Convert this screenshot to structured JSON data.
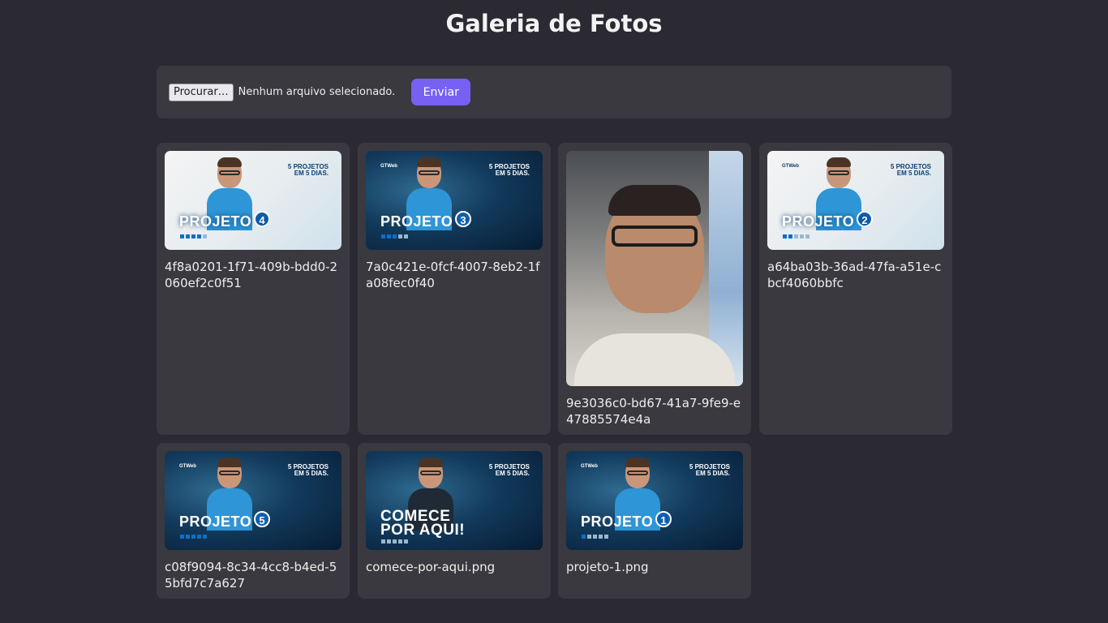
{
  "page": {
    "title": "Galeria de Fotos"
  },
  "upload": {
    "browse_label": "Procurar…",
    "no_file_text": "Nenhum arquivo selecionado.",
    "send_label": "Enviar"
  },
  "colors": {
    "background": "#2b2a33",
    "card": "#3a393f",
    "accent": "#7761f2"
  },
  "gallery": [
    {
      "caption": "4f8a0201-1f71-409b-bdd0-2060ef2c0f51",
      "thumb": {
        "title": "PROJETO",
        "number": "4",
        "tag": "5 PROJETOS EM 5 DIAS."
      }
    },
    {
      "caption": "7a0c421e-0fcf-4007-8eb2-1fa08fec0f40",
      "thumb": {
        "title": "PROJETO",
        "number": "3",
        "tag": "5 PROJETOS EM 5 DIAS."
      }
    },
    {
      "caption": "9e3036c0-bd67-41a7-9fe9-e47885574e4a"
    },
    {
      "caption": "a64ba03b-36ad-47fa-a51e-cbcf4060bbfc",
      "thumb": {
        "title": "PROJETO",
        "number": "2",
        "tag": "5 PROJETOS EM 5 DIAS."
      }
    },
    {
      "caption": "c08f9094-8c34-4cc8-b4ed-55bfd7c7a627",
      "thumb": {
        "title": "PROJETO",
        "number": "5",
        "tag": "5 PROJETOS EM 5 DIAS."
      }
    },
    {
      "caption": "comece-por-aqui.png",
      "thumb": {
        "title_line1": "COMECE",
        "title_line2": "POR AQUI!",
        "tag": "5 PROJETOS EM 5 DIAS."
      }
    },
    {
      "caption": "projeto-1.png",
      "thumb": {
        "title": "PROJETO",
        "number": "1",
        "tag": "5 PROJETOS EM 5 DIAS."
      }
    }
  ]
}
